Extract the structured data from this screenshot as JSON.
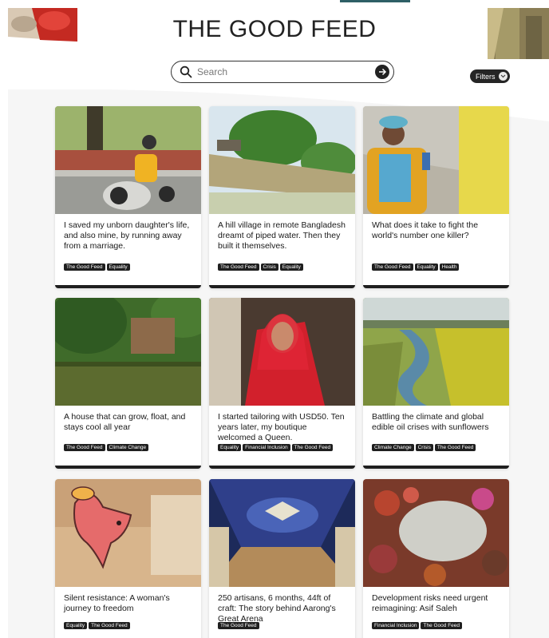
{
  "site": {
    "title": "THE GOOD FEED"
  },
  "search": {
    "placeholder": "Search"
  },
  "filters": {
    "label": "Filters"
  },
  "cards": [
    {
      "title": "I saved my unborn daughter's life, and also mine, by running away from a marriage.",
      "tags": [
        "The Good Feed",
        "Equality"
      ],
      "image": "scooter-rider-photo"
    },
    {
      "title": "A hill village in remote Bangladesh dreamt of piped water. Then they built it themselves.",
      "tags": [
        "The Good Feed",
        "Crisis",
        "Equality"
      ],
      "image": "riverbank-village-photo"
    },
    {
      "title": "What does it take to fight the world's number one killer?",
      "tags": [
        "The Good Feed",
        "Equality",
        "Health"
      ],
      "image": "health-worker-photo"
    },
    {
      "title": "A house that can grow, float, and stays cool all year",
      "tags": [
        "The Good Feed",
        "Climate Change"
      ],
      "image": "floating-house-photo"
    },
    {
      "title": "I started tailoring with USD50. Ten years later, my boutique welcomed a Queen.",
      "tags": [
        "Equality",
        "Financial Inclusion",
        "The Good Feed"
      ],
      "image": "tailor-woman-photo"
    },
    {
      "title": "Battling the climate and global edible oil crises with sunflowers",
      "tags": [
        "Climate Change",
        "Crisis",
        "The Good Feed"
      ],
      "image": "sunflower-fields-photo"
    },
    {
      "title": "Silent resistance: A woman's journey to freedom",
      "tags": [
        "Equality",
        "The Good Feed"
      ],
      "image": "fish-illustration"
    },
    {
      "title": "250 artisans, 6 months, 44ft of craft: The story behind Aarong's Great Arena",
      "tags": [
        "The Good Feed"
      ],
      "image": "arena-ceiling-photo"
    },
    {
      "title": "Development risks need urgent reimagining: Asif Saleh",
      "tags": [
        "Financial Inclusion",
        "The Good Feed"
      ],
      "image": "circle-gathering-photo"
    }
  ]
}
